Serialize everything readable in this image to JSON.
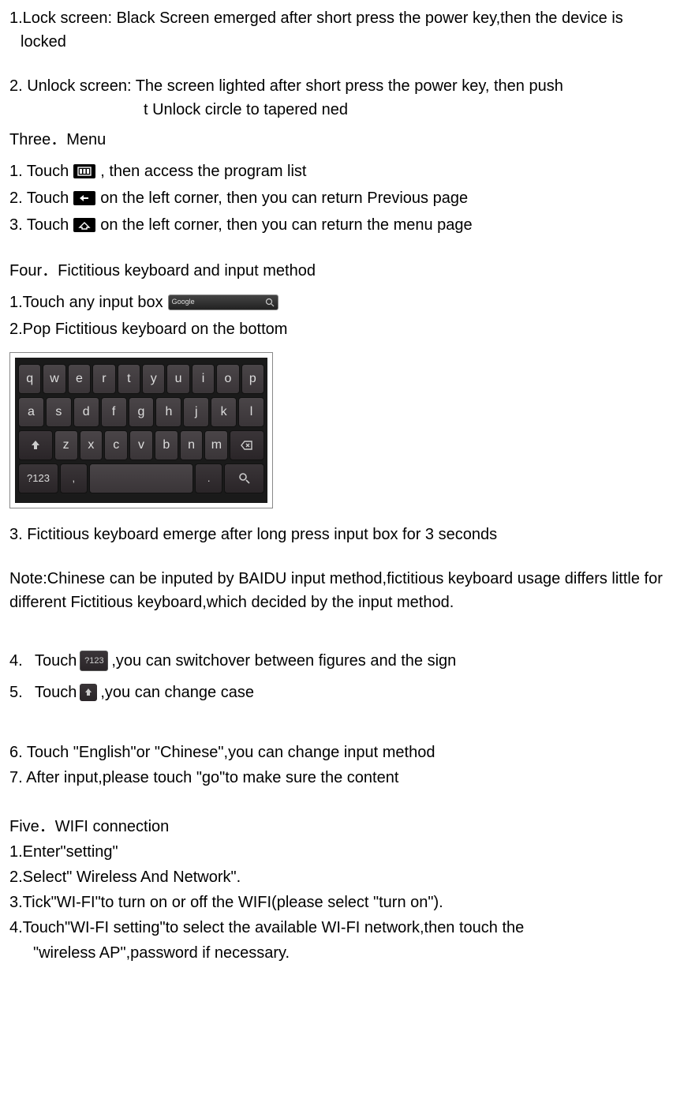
{
  "lock_screen": {
    "line1": "1.Lock screen: Black Screen emerged after short press the power key,then the device is",
    "line2": "locked"
  },
  "unlock_screen": {
    "line1": "2. Unlock screen: The screen lighted after short press the power key, then push",
    "line2": "t Unlock circle to tapered ned"
  },
  "three_header": "Three．Menu",
  "menu": {
    "item1_pre": "1. Touch ",
    "item1_post": " , then access the program list",
    "item2_pre": "2. Touch ",
    "item2_post": " on the left corner, then you can return Previous page",
    "item3_pre": "3. Touch ",
    "item3_post": " on the left corner, then you can return the menu page"
  },
  "four_header": "Four．Fictitious keyboard and input method",
  "four": {
    "item1": "1.Touch any input box ",
    "item2": "2.Pop Fictitious keyboard on the bottom",
    "item3": "3. Fictitious keyboard emerge after long press input box for 3 seconds",
    "note": "Note:Chinese can be inputed by BAIDU input method,fictitious keyboard usage differs little for different Fictitious keyboard,which decided by the input method.",
    "item4_num": "4.",
    "item4_pre": "Touch ",
    "item4_post": ",you can switchover between figures and the sign",
    "item5_num": "5.",
    "item5_pre": "Touch ",
    "item5_post": ",you can change case",
    "item6": "6.   Touch \"English\"or \"Chinese\",you can change input method",
    "item7": "7.   After input,please touch \"go\"to make sure the content"
  },
  "five_header": "Five．WIFI connection",
  "five": {
    "item1": "1.Enter\"setting\"",
    "item2": "2.Select\" Wireless And Network\".",
    "item3": "3.Tick\"WI-FI\"to turn on or off the WIFI(please select \"turn on\").",
    "item4_line1": "4.Touch\"WI-FI setting\"to select the available WI-FI network,then touch the",
    "item4_line2": "\"wireless AP\",password if necessary."
  },
  "keyboard": {
    "row1": [
      "q",
      "w",
      "e",
      "r",
      "t",
      "y",
      "u",
      "i",
      "o",
      "p"
    ],
    "row2": [
      "a",
      "s",
      "d",
      "f",
      "g",
      "h",
      "j",
      "k",
      "l"
    ],
    "row3_mid": [
      "z",
      "x",
      "c",
      "v",
      "b",
      "n",
      "m"
    ],
    "numkey": "?123",
    "period": "."
  },
  "search_label": "Google",
  "numkey_label": "?123"
}
